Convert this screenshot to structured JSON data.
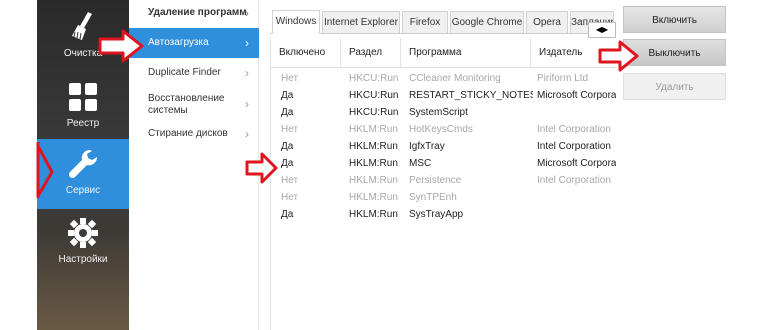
{
  "sidebar": {
    "items": [
      {
        "label": "Очистка",
        "icon": "broom-icon"
      },
      {
        "label": "Реестр",
        "icon": "grid-icon"
      },
      {
        "label": "Сервис",
        "icon": "wrench-icon"
      },
      {
        "label": "Настройки",
        "icon": "gear-icon"
      }
    ],
    "active_index": 2,
    "active_color": "#2f8fdc"
  },
  "submenu": {
    "items": [
      {
        "label": "Удаление программ"
      },
      {
        "label": "Автозагрузка"
      },
      {
        "label": "Duplicate Finder"
      },
      {
        "label": "Восстановление системы"
      },
      {
        "label": "Стирание дисков"
      }
    ],
    "active_index": 1
  },
  "tabs": {
    "items": [
      "Windows",
      "Internet Explorer",
      "Firefox",
      "Google Chrome",
      "Opera",
      "Запланир"
    ],
    "active_index": 0,
    "scroll_left": "◀",
    "scroll_right": "▶"
  },
  "table": {
    "columns": [
      "Включено",
      "Раздел",
      "Программа",
      "Издатель"
    ],
    "rows": [
      {
        "enabled": "Нет",
        "key": "HKCU:Run",
        "program": "CCleaner Monitoring",
        "publisher": "Piriform Ltd",
        "off": true
      },
      {
        "enabled": "Да",
        "key": "HKCU:Run",
        "program": "RESTART_STICKY_NOTES",
        "publisher": "Microsoft Corporat",
        "off": false
      },
      {
        "enabled": "Да",
        "key": "HKCU:Run",
        "program": "SystemScript",
        "publisher": "",
        "off": false
      },
      {
        "enabled": "Нет",
        "key": "HKLM:Run",
        "program": "HotKeysCmds",
        "publisher": "Intel Corporation",
        "off": true
      },
      {
        "enabled": "Да",
        "key": "HKLM:Run",
        "program": "IgfxTray",
        "publisher": "Intel Corporation",
        "off": false
      },
      {
        "enabled": "Да",
        "key": "HKLM:Run",
        "program": "MSC",
        "publisher": "Microsoft Corporat",
        "off": false
      },
      {
        "enabled": "Нет",
        "key": "HKLM:Run",
        "program": "Persistence",
        "publisher": "Intel Corporation",
        "off": true
      },
      {
        "enabled": "Нет",
        "key": "HKLM:Run",
        "program": "SynTPEnh",
        "publisher": "",
        "off": true
      },
      {
        "enabled": "Да",
        "key": "HKLM:Run",
        "program": "SysTrayApp",
        "publisher": "",
        "off": false
      }
    ]
  },
  "actions": {
    "enable": "Включить",
    "disable": "Выключить",
    "delete": "Удалить"
  },
  "colors": {
    "accent": "#2f8fdc",
    "annotation_arrow": "#e0141e"
  }
}
